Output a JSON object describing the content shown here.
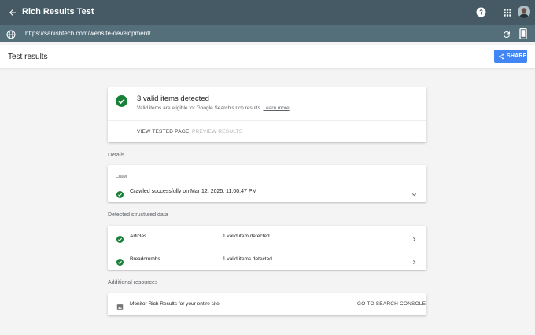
{
  "appbar": {
    "title": "Rich Results Test",
    "bg_color": "#455a64"
  },
  "urlbar": {
    "url": "https://sanishtech.com/website-development/",
    "bg_color": "#546e7a"
  },
  "results_header": {
    "heading": "Test results",
    "share_label": "SHARE",
    "share_color": "#4285f4"
  },
  "summary": {
    "title": "3 valid items detected",
    "subtitle": "Valid items are eligible for Google Search's rich results.",
    "learn_more": "Learn more",
    "actions": {
      "view_tested_page": "VIEW TESTED PAGE",
      "preview_results": "PREVIEW RESULTS"
    },
    "status_color": "#188038"
  },
  "sections": {
    "details": "Details",
    "detected": "Detected structured data",
    "additional": "Additional resources"
  },
  "details": {
    "label": "Crawl",
    "status": "Crawled successfully on Mar 12, 2025, 11:00:47 PM"
  },
  "structured_data": [
    {
      "name": "Articles",
      "count": "1 valid item detected"
    },
    {
      "name": "Breadcrumbs",
      "count": "1 valid items detected"
    }
  ],
  "resources": {
    "text": "Monitor Rich Results for your entire site",
    "link": "GO TO SEARCH CONSOLE"
  },
  "icons": {
    "back": "arrow-left-icon",
    "help": "help-circle-icon",
    "apps": "apps-grid-icon",
    "globe": "globe-icon",
    "refresh": "refresh-icon",
    "device": "smartphone-icon",
    "share": "share-icon",
    "check": "check-circle-icon",
    "expand": "chevron-down-icon",
    "arrow": "chevron-right-icon",
    "image": "image-icon"
  }
}
